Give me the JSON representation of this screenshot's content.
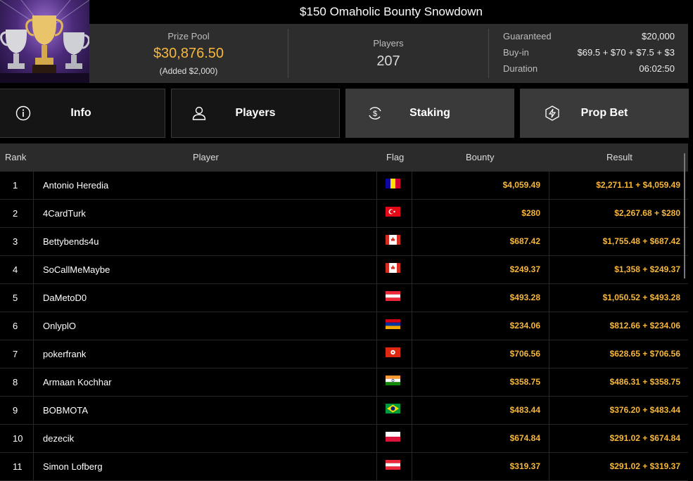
{
  "tournament": {
    "title": "$150 Omaholic Bounty Snowdown",
    "prize_pool_label": "Prize Pool",
    "prize_pool_value": "$30,876.50",
    "prize_pool_added": "(Added $2,000)",
    "players_label": "Players",
    "players_value": "207",
    "guaranteed_label": "Guaranteed",
    "guaranteed_value": "$20,000",
    "buyin_label": "Buy-in",
    "buyin_value": "$69.5 + $70 + $7.5 + $3",
    "duration_label": "Duration",
    "duration_value": "06:02:50"
  },
  "tabs": [
    {
      "label": "Info",
      "icon": "info-icon"
    },
    {
      "label": "Players",
      "icon": "user-icon"
    },
    {
      "label": "Staking",
      "icon": "dollar-cycle-icon",
      "active": true
    },
    {
      "label": "Prop Bet",
      "icon": "lightning-icon"
    }
  ],
  "table": {
    "headers": {
      "rank": "Rank",
      "player": "Player",
      "flag": "Flag",
      "bounty": "Bounty",
      "result": "Result"
    },
    "rows": [
      {
        "rank": "1",
        "player": "Antonio Heredia",
        "flag": "andorra",
        "bounty": "$4,059.49",
        "result": "$2,271.11 + $4,059.49"
      },
      {
        "rank": "2",
        "player": "4CardTurk",
        "flag": "turkey",
        "bounty": "$280",
        "result": "$2,267.68 + $280"
      },
      {
        "rank": "3",
        "player": "Bettybends4u",
        "flag": "canada",
        "bounty": "$687.42",
        "result": "$1,755.48 + $687.42"
      },
      {
        "rank": "4",
        "player": "SoCallMeMaybe",
        "flag": "canada",
        "bounty": "$249.37",
        "result": "$1,358 + $249.37"
      },
      {
        "rank": "5",
        "player": "DaMetoD0",
        "flag": "austria",
        "bounty": "$493.28",
        "result": "$1,050.52 + $493.28"
      },
      {
        "rank": "6",
        "player": "OnlyplO",
        "flag": "armenia",
        "bounty": "$234.06",
        "result": "$812.66 + $234.06"
      },
      {
        "rank": "7",
        "player": "pokerfrank",
        "flag": "hong-kong",
        "bounty": "$706.56",
        "result": "$628.65 + $706.56"
      },
      {
        "rank": "8",
        "player": "Armaan Kochhar",
        "flag": "india",
        "bounty": "$358.75",
        "result": "$486.31 + $358.75"
      },
      {
        "rank": "9",
        "player": "BOBMOTA",
        "flag": "brazil",
        "bounty": "$483.44",
        "result": "$376.20 + $483.44"
      },
      {
        "rank": "10",
        "player": "dezecik",
        "flag": "poland",
        "bounty": "$674.84",
        "result": "$291.02 + $674.84"
      },
      {
        "rank": "11",
        "player": "Simon Lofberg",
        "flag": "austria",
        "bounty": "$319.37",
        "result": "$291.02 + $319.37"
      }
    ]
  },
  "colors": {
    "accent": "#f6b73c",
    "panel": "#2d2d2d",
    "active_tab": "#3a3a3a"
  }
}
